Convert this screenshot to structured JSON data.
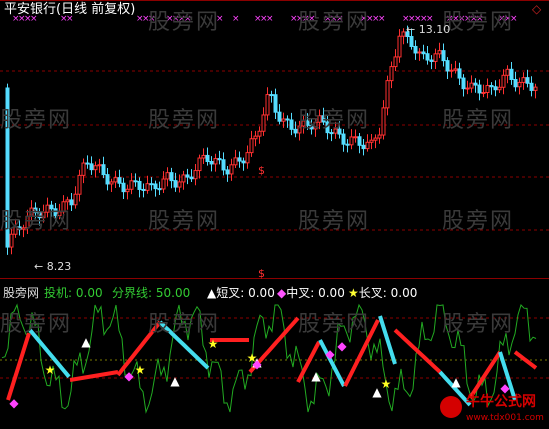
{
  "window": {
    "title": "平安银行(日线 前复权)",
    "corner_icon": "diamond-outline-icon"
  },
  "price_panel": {
    "high_label": "← 13.10",
    "low_label": "← 8.23",
    "marker": "$",
    "gridline_color": "#8b0000",
    "up_color": "#ff3030",
    "down_color": "#55ddff",
    "tick_mark_color": "#ff44ff"
  },
  "indicator_header": {
    "source": "股旁网",
    "items": [
      {
        "label": "投机:",
        "value": "0.00",
        "color": "#33cc33"
      },
      {
        "label": "分界线:",
        "value": "50.00",
        "color": "#33cc33"
      },
      {
        "label": "短叉:",
        "value": "0.00",
        "color": "#ffffff",
        "icon": "triangle-icon"
      },
      {
        "label": "中叉:",
        "value": "0.00",
        "color": "#ffffff",
        "icon": "diamond-icon"
      },
      {
        "label": "长叉:",
        "value": "0.00",
        "color": "#ffffff",
        "icon": "star-icon"
      }
    ]
  },
  "watermark": "股旁网",
  "footer_logo": {
    "text": "牛牛公式网",
    "url": "www.tdx001.com",
    "color": "#d40000"
  }
}
